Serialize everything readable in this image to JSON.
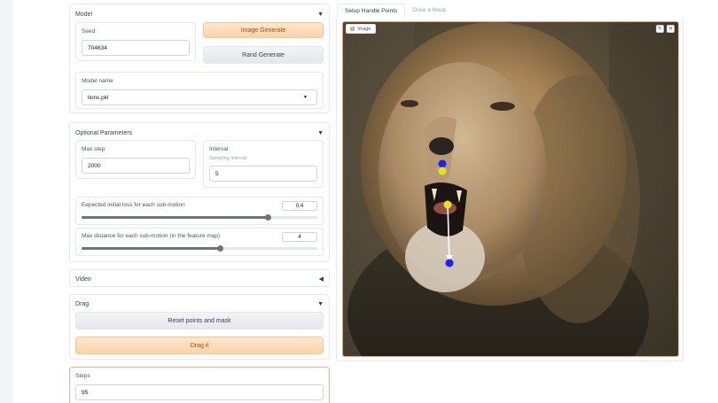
{
  "model_section": {
    "title": "Model",
    "seed_label": "Seed",
    "seed_value": "704634",
    "image_generate_label": "Image Generate",
    "rand_generate_label": "Rand Generate",
    "model_name_label": "Model name",
    "model_name_value": "lions.pkl"
  },
  "optional_section": {
    "title": "Optional Parameters",
    "max_step_label": "Max step",
    "max_step_value": "2000",
    "interval_label": "Interval",
    "interval_hint": "Sampling interval",
    "interval_value": "5",
    "loss_label": "Eepected initial loss for each sub-motion",
    "loss_value": "0.4",
    "loss_fraction": 0.79,
    "distance_label": "Max distance for each sub-motion (in the feature map)",
    "distance_value": "4",
    "distance_fraction": 0.59
  },
  "video_section": {
    "title": "Video"
  },
  "drag_section": {
    "title": "Drag",
    "reset_label": "Reset points and mask",
    "drag_label": "Drag it"
  },
  "steps_section": {
    "label": "Steps",
    "value": "95"
  },
  "tabs": [
    "Setup Handle Points",
    "Draw a Mask"
  ],
  "image_panel": {
    "badge_label": "Image"
  },
  "icons": {
    "collapse": "triangle-down-icon",
    "expand": "triangle-left-icon",
    "dropdown": "caret-down-icon",
    "image": "image-icon",
    "edit": "pencil-icon",
    "close": "close-icon"
  },
  "colors": {
    "accent": "#c2410c",
    "handle_point": "#1d1dff",
    "target_point": "#e5e510"
  }
}
